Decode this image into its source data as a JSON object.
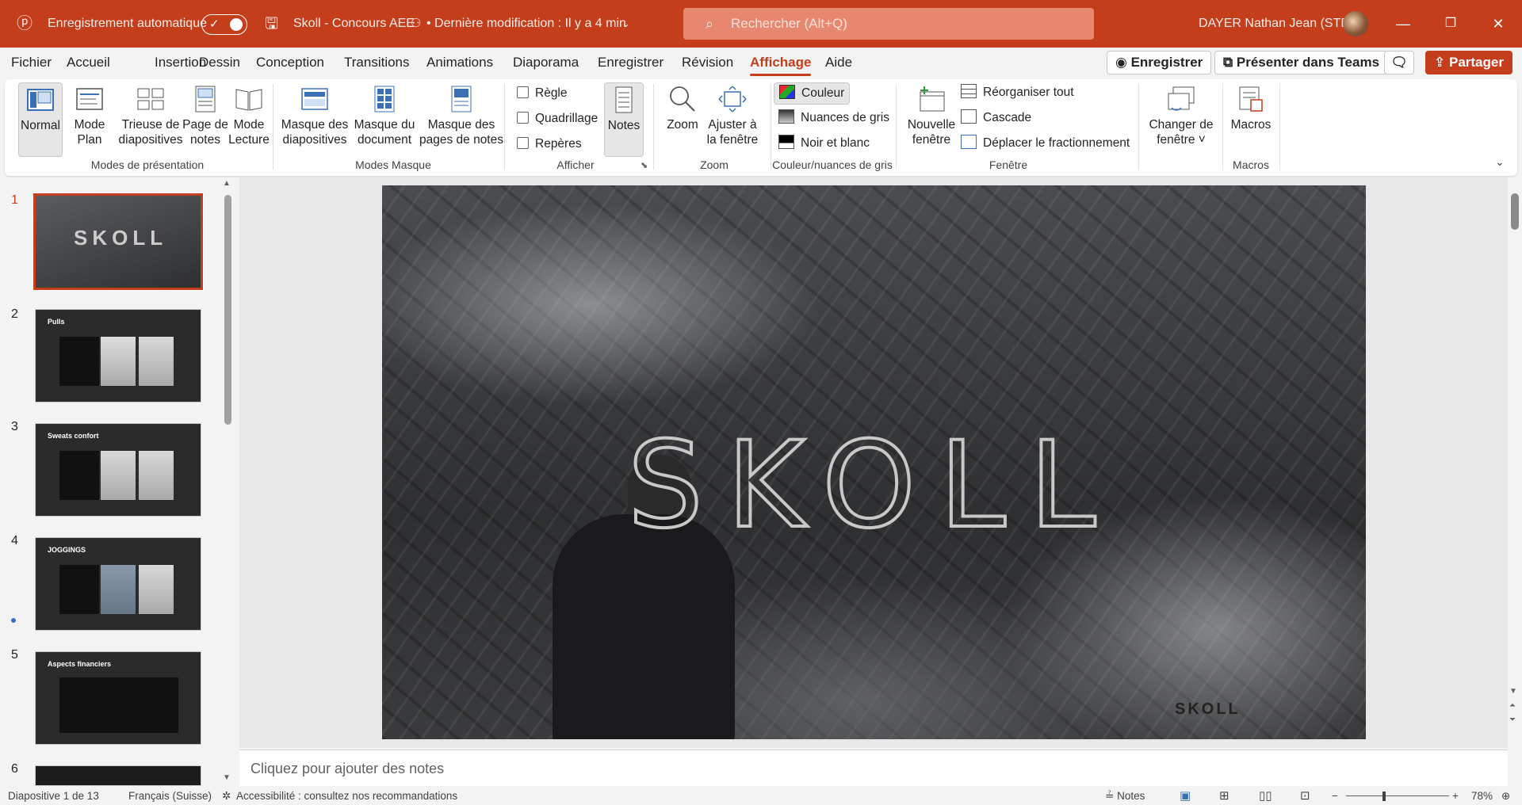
{
  "titlebar": {
    "autosave_label": "Enregistrement automatique",
    "autosave_check": "✓",
    "doc_title": "Skoll - Concours AEE",
    "last_modified": "• Dernière modification : Il y a 4 min",
    "search_placeholder": "Rechercher (Alt+Q)",
    "user_name": "DAYER Nathan Jean (STD)",
    "accent_color": "#c43e1c"
  },
  "menu": {
    "items": [
      "Fichier",
      "Accueil",
      "Insertion",
      "Dessin",
      "Conception",
      "Transitions",
      "Animations",
      "Diaporama",
      "Enregistrer",
      "Révision",
      "Affichage",
      "Aide"
    ],
    "active": "Affichage",
    "record_label": "Enregistrer",
    "teams_label": "Présenter dans Teams",
    "share_label": "Partager"
  },
  "ribbon": {
    "groups": {
      "presentation_modes": "Modes de présentation",
      "master_modes": "Modes Masque",
      "show": "Afficher",
      "zoom": "Zoom",
      "color": "Couleur/nuances de gris",
      "window": "Fenêtre",
      "macros": "Macros"
    },
    "normal": "Normal",
    "outline_1": "Mode",
    "outline_2": "Plan",
    "sorter_1": "Trieuse de",
    "sorter_2": "diapositives",
    "notes_page_1": "Page de",
    "notes_page_2": "notes",
    "reading_1": "Mode",
    "reading_2": "Lecture",
    "slide_master_1": "Masque des",
    "slide_master_2": "diapositives",
    "handout_master_1": "Masque du",
    "handout_master_2": "document",
    "notes_master_1": "Masque des",
    "notes_master_2": "pages de notes",
    "ruler": "Règle",
    "gridlines": "Quadrillage",
    "guides": "Repères",
    "notes": "Notes",
    "zoom": "Zoom",
    "fit_1": "Ajuster à",
    "fit_2": "la fenêtre",
    "color": "Couleur",
    "grayscale": "Nuances de gris",
    "bw": "Noir et blanc",
    "new_window_1": "Nouvelle",
    "new_window_2": "fenêtre",
    "arrange_all": "Réorganiser tout",
    "cascade": "Cascade",
    "move_split": "Déplacer le fractionnement",
    "switch_1": "Changer de",
    "switch_2": "fenêtre ˅",
    "macros": "Macros"
  },
  "thumbnails": [
    {
      "num": "1",
      "title": ""
    },
    {
      "num": "2",
      "title": "Pulls"
    },
    {
      "num": "3",
      "title": "Sweats confort"
    },
    {
      "num": "4",
      "title": "JOGGINGS"
    },
    {
      "num": "5",
      "title": "Aspects financiers"
    },
    {
      "num": "6",
      "title": ""
    }
  ],
  "slide": {
    "logo_text": "SKOLL"
  },
  "notes_placeholder": "Cliquez pour ajouter des notes",
  "status": {
    "slide_info": "Diapositive 1 de 13",
    "language": "Français (Suisse)",
    "accessibility": "Accessibilité : consultez nos recommandations",
    "notes_btn": "Notes",
    "zoom_level": "78%"
  }
}
